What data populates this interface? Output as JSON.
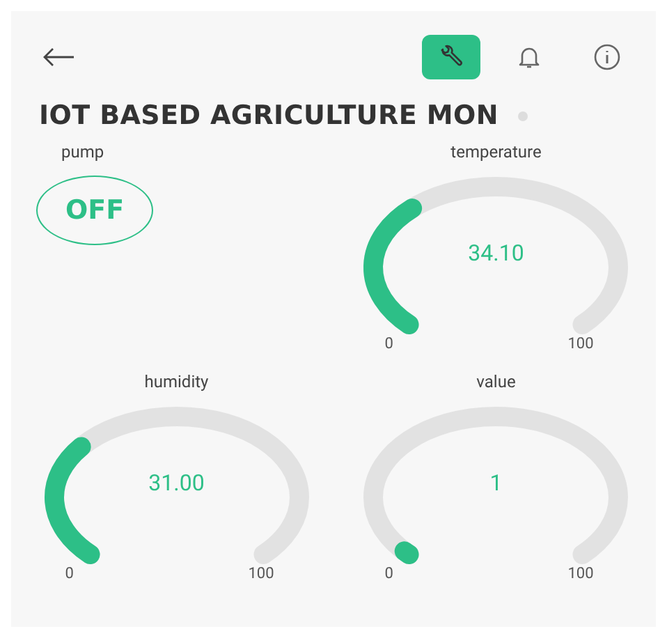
{
  "header": {
    "actions": [
      {
        "kind": "wrench",
        "selected": true
      },
      {
        "kind": "bell",
        "selected": false
      },
      {
        "kind": "info",
        "selected": false
      }
    ]
  },
  "title": "IOT BASED AGRICULTURE MON",
  "widgets": [
    {
      "kind": "button",
      "label": "pump",
      "value": "OFF"
    },
    {
      "kind": "gauge",
      "label": "temperature",
      "value": "34.10",
      "min": "0",
      "max": "100"
    },
    {
      "kind": "gauge",
      "label": "humidity",
      "value": "31.00",
      "min": "0",
      "max": "100"
    },
    {
      "kind": "gauge",
      "label": "value",
      "value": "1",
      "min": "0",
      "max": "100"
    }
  ]
}
